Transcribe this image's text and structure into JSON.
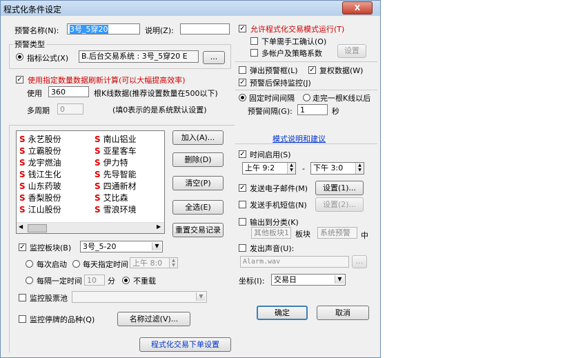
{
  "window": {
    "title": "程式化条件设定",
    "close_label": "X"
  },
  "left": {
    "alert_name_label": "预警名称(N):",
    "alert_name_value": "3号_5穿20",
    "desc_label": "说明(Z):",
    "desc_value": "",
    "alert_type_group": "预警类型",
    "indicator_label": "指标公式(X)",
    "indicator_value": "B.后台交易系统 : 3号_5穿20 E",
    "browse_label": "...",
    "use_data_check_label": "使用指定数量数据刷新计算(可以大幅提高效率)",
    "use_label": "使用",
    "use_value": "360",
    "kline_desc": "根K线数据(推荐设置数量在500以下)",
    "multi_period_label": "多周期",
    "multi_period_value": "0",
    "default_note": "(填0表示的是系统默认设置)",
    "stocks": [
      [
        "永艺股份",
        "南山铝业"
      ],
      [
        "立霸股份",
        "亚星客车"
      ],
      [
        "龙宇燃油",
        "伊力特"
      ],
      [
        "钱江生化",
        "先导智能"
      ],
      [
        "山东药玻",
        "四通新材"
      ],
      [
        "香梨股份",
        "艾比森"
      ],
      [
        "江山股份",
        "雪浪环境"
      ]
    ],
    "stock_marker": "S",
    "add_label": "加入(A)...",
    "delete_label": "删除(D)",
    "clear_label": "清空(P)",
    "selectall_label": "全选(E)",
    "reset_label": "重置交易记录",
    "monitor_block_label": "监控板块(B)",
    "monitor_block_value": "3号_5-20",
    "each_start_label": "每次启动",
    "daily_time_label": "每天指定时间",
    "daily_time_value": "上午  8:0",
    "interval_label": "每隔一定时间",
    "interval_value": "10",
    "minute_label": "分",
    "no_repeat_label": "不重载",
    "monitor_pool_label": "监控股票池",
    "monitor_pool_value": "",
    "halted_label": "监控停牌的品种(Q)",
    "name_filter_label": "名称过滤(V)...",
    "order_settings_label": "程式化交易下单设置"
  },
  "right": {
    "allow_program_trade": "允许程式化交易模式运行(T)",
    "manual_confirm": "下单需手工确认(O)",
    "multi_account": "多帐户及策略系数",
    "settings_label": "设置",
    "popup_alert": "弹出预警框(L)",
    "restore_data": "复权数据(W)",
    "keep_monitor": "预警后保持监控(J)",
    "fixed_interval": "固定时间间隔",
    "after_kline": "走完一根K线以后",
    "alert_interval_label": "预警间隔(G):",
    "alert_interval_value": "1",
    "second_label": "秒",
    "mode_link": "模式说明和建议",
    "time_enable": "时间启用(S)",
    "time_from": "上午  9:2",
    "time_dash": "-",
    "time_to": "下午  3:0",
    "send_email": "发送电子邮件(M)",
    "email_settings": "设置(1)...",
    "send_sms": "发送手机短信(N)",
    "sms_settings": "设置(2)...",
    "output_category": "输出到分类(K)",
    "other_block": "其他板块1",
    "block_label": "板块",
    "sys_alert": "系统预警",
    "middle_label": "中",
    "play_sound": "发出声音(U):",
    "sound_file": "Alarm.wav",
    "sound_browse": "...",
    "coord_label": "坐标(I):",
    "coord_value": "交易日",
    "ok_label": "确定",
    "cancel_label": "取消"
  },
  "colors": {
    "accent_red": "#d00000",
    "link_blue": "#0033cc",
    "stock_marker": "#e00000"
  }
}
